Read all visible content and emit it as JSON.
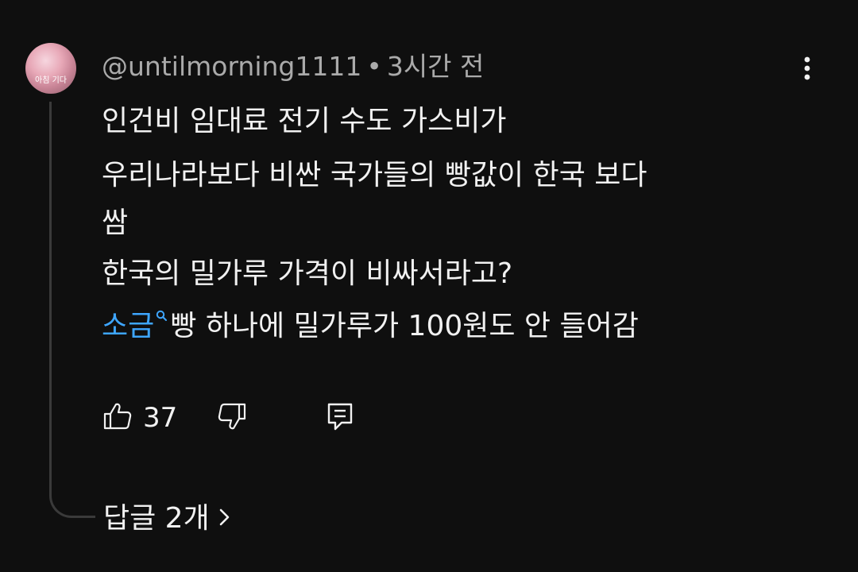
{
  "comment": {
    "author": "@untilmorning1111",
    "separator": "•",
    "timestamp": "3시간 전",
    "avatar_text": "아침 기다",
    "lines": [
      "인건비 임대료 전기 수도 가스비가",
      "우리나라보다 비싼 국가들의 빵값이 한국 보다",
      "쌈",
      "한국의 밀가루 가격이 비싸서라고?"
    ],
    "last_line": {
      "link_text": "소금",
      "rest": "빵 하나에 밀가루가 100원도 안 들어감"
    },
    "like_count": "37",
    "replies_label": "답글 2개"
  },
  "icons": {
    "more": "more-vert-icon",
    "search": "search-icon",
    "like": "thumbs-up-icon",
    "dislike": "thumbs-down-icon",
    "reply": "reply-icon",
    "chevron": "chevron-right-icon"
  },
  "colors": {
    "background": "#0f0f0f",
    "text": "#f1f1f1",
    "secondary_text": "#aaaaaa",
    "link": "#3ea6ff",
    "thread_line": "#3a3a3a"
  }
}
